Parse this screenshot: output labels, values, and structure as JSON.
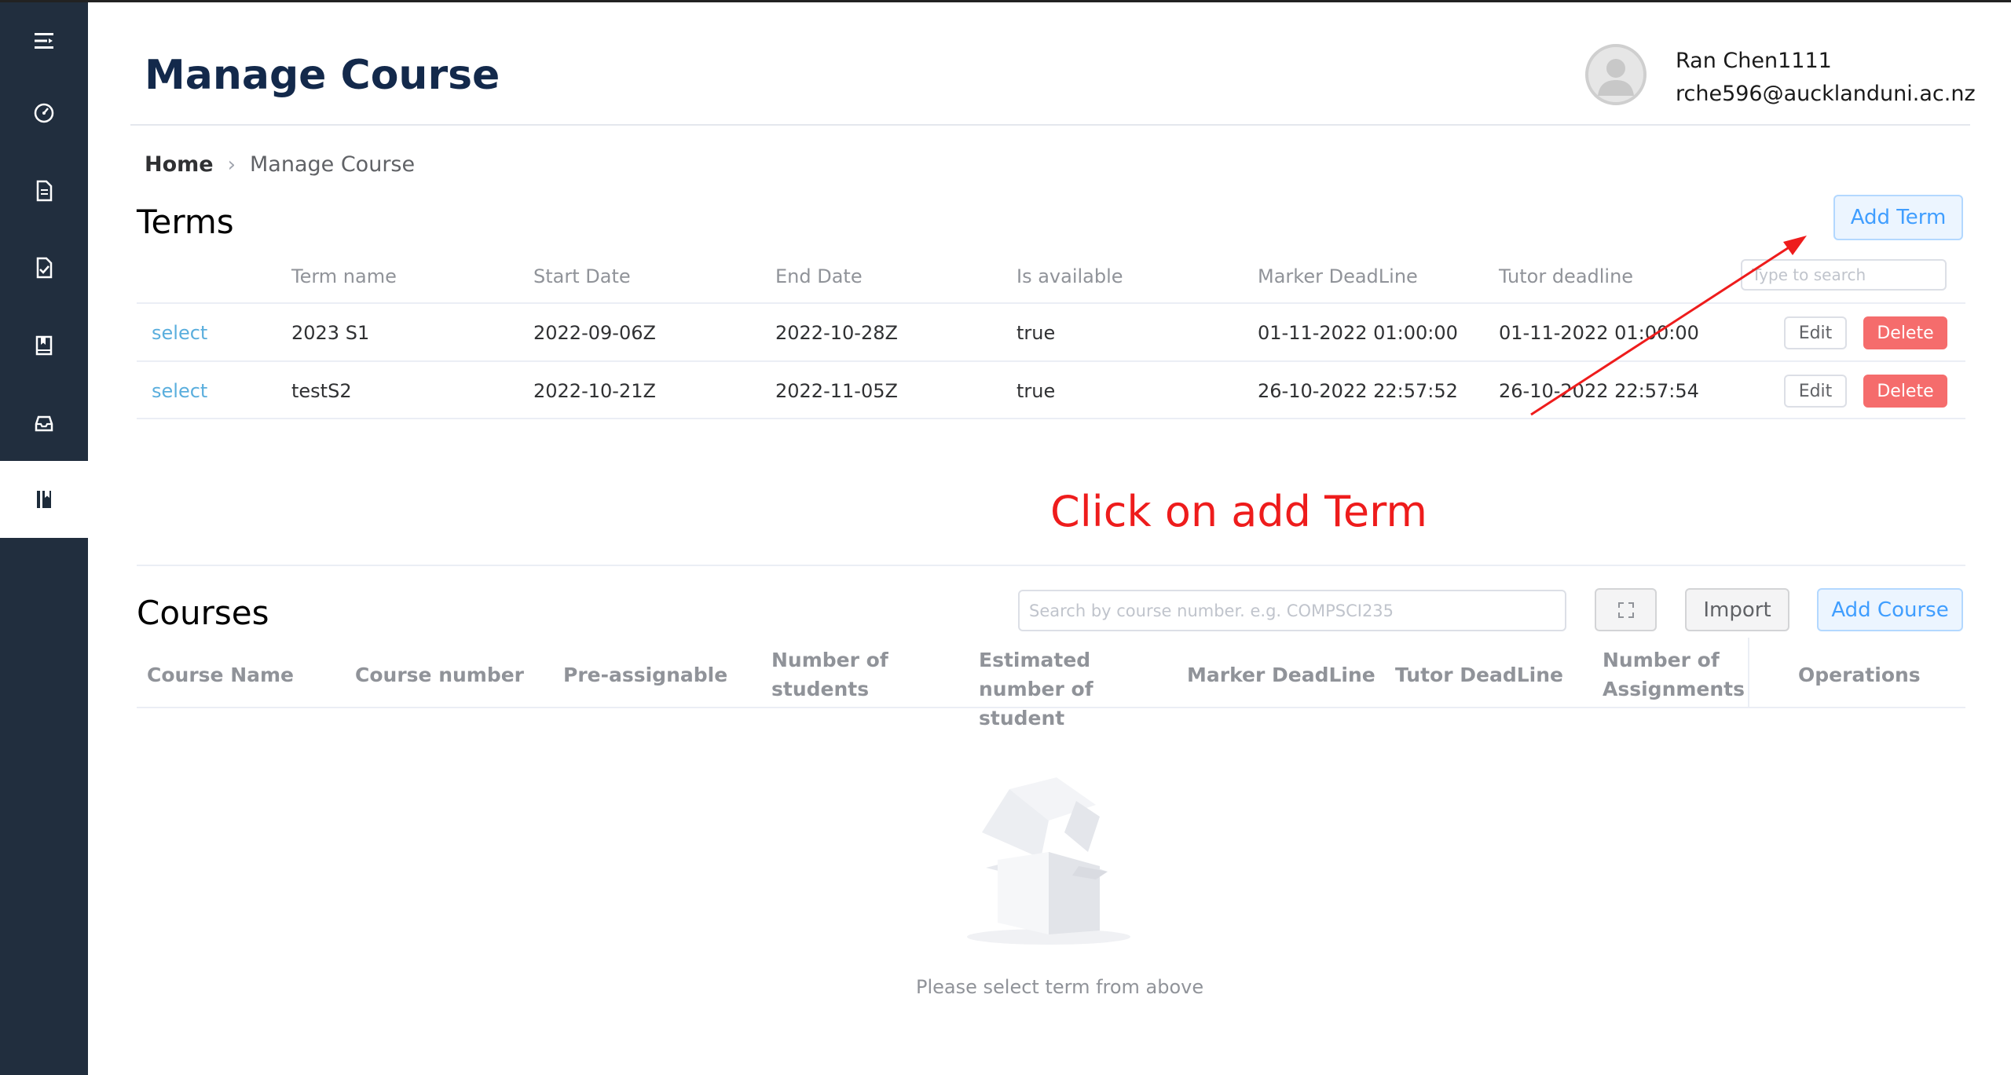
{
  "header": {
    "title": "Manage Course",
    "user_name": "Ran Chen1111",
    "user_email": "rche596@aucklanduni.ac.nz"
  },
  "sidebar": {
    "items": [
      {
        "icon": "menu-icon"
      },
      {
        "icon": "dashboard-icon"
      },
      {
        "icon": "document-icon"
      },
      {
        "icon": "checklist-icon"
      },
      {
        "icon": "book-icon"
      },
      {
        "icon": "inbox-icon"
      },
      {
        "icon": "course-icon",
        "active": true
      }
    ]
  },
  "breadcrumb": {
    "home": "Home",
    "current": "Manage Course"
  },
  "terms": {
    "title": "Terms",
    "add_label": "Add Term",
    "search_placeholder": "Type to search",
    "columns": [
      "Term name",
      "Start Date",
      "End Date",
      "Is available",
      "Marker DeadLine",
      "Tutor deadline"
    ],
    "rows": [
      {
        "select": "select",
        "name": "2023 S1",
        "start": "2022-09-06Z",
        "end": "2022-10-28Z",
        "available": "true",
        "marker": "01-11-2022 01:00:00",
        "tutor": "01-11-2022 01:00:00",
        "edit": "Edit",
        "delete": "Delete"
      },
      {
        "select": "select",
        "name": "testS2",
        "start": "2022-10-21Z",
        "end": "2022-11-05Z",
        "available": "true",
        "marker": "26-10-2022 22:57:52",
        "tutor": "26-10-2022 22:57:54",
        "edit": "Edit",
        "delete": "Delete"
      }
    ]
  },
  "annotation": {
    "text": "Click on add Term",
    "color": "#ee1c1c"
  },
  "courses": {
    "title": "Courses",
    "search_placeholder": "Search by course number. e.g. COMPSCI235",
    "import_label": "Import",
    "add_label": "Add Course",
    "columns": [
      "Course Name",
      "Course number",
      "Pre-assignable",
      "Number of students",
      "Estimated number of student",
      "Marker DeadLine",
      "Tutor DeadLine",
      "Number of Assignments",
      "Operations"
    ],
    "empty_text": "Please select term from above"
  },
  "colors": {
    "sidebar": "#212e3e",
    "title": "#13294b",
    "primary": "#409eff",
    "danger": "#f56c6c",
    "link": "#5aaedd"
  }
}
